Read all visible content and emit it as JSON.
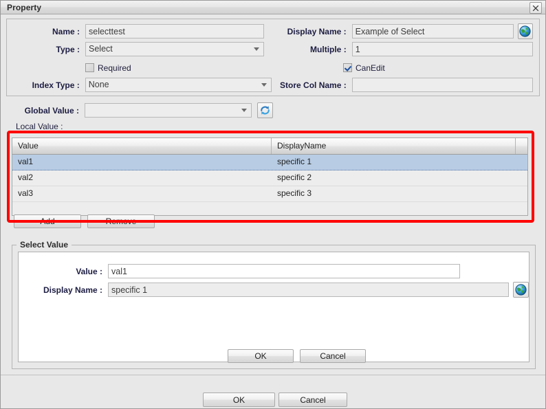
{
  "window": {
    "title": "Property",
    "close_icon": "close-icon"
  },
  "property": {
    "name": {
      "label": "Name :",
      "value": "selecttest"
    },
    "display_name": {
      "label": "Display Name :",
      "value": "Example of Select",
      "globe_icon": "globe-icon"
    },
    "type": {
      "label": "Type :",
      "value": "Select",
      "options": [
        "Select"
      ]
    },
    "multiple": {
      "label": "Multiple :",
      "value": "1"
    },
    "required": {
      "label": "Required",
      "checked": false
    },
    "can_edit": {
      "label": "CanEdit",
      "checked": true
    },
    "index_type": {
      "label": "Index Type :",
      "value": "None",
      "options": [
        "None"
      ]
    },
    "store_col_name": {
      "label": "Store Col Name :",
      "value": ""
    },
    "global_value": {
      "label": "Global Value :",
      "value": "",
      "options": []
    },
    "refresh_icon": "refresh-icon",
    "local_value_label": "Local Value :"
  },
  "table": {
    "columns": [
      "Value",
      "DisplayName",
      ""
    ],
    "rows": [
      {
        "value": "val1",
        "display_name": "specific 1",
        "selected": true
      },
      {
        "value": "val2",
        "display_name": "specific 2",
        "selected": false
      },
      {
        "value": "val3",
        "display_name": "specific 3",
        "selected": false
      }
    ]
  },
  "table_buttons": {
    "add": "Add",
    "remove": "Remove"
  },
  "select_value": {
    "legend": "Select Value",
    "value": {
      "label": "Value :",
      "value": "val1"
    },
    "display_name": {
      "label": "Display Name :",
      "value": "specific 1",
      "globe_icon": "globe-icon"
    },
    "ok": "OK",
    "cancel": "Cancel"
  },
  "footer": {
    "ok": "OK",
    "cancel": "Cancel"
  },
  "annotation": {
    "highlight_color": "#ff0000"
  }
}
